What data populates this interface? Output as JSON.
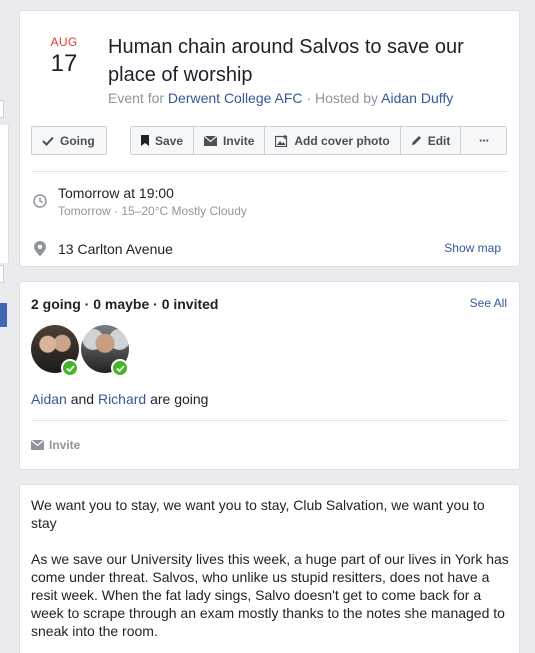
{
  "event": {
    "month": "AUG",
    "day": "17",
    "title": "Human chain around Salvos to save our place of worship",
    "meta_prefix": "Event for",
    "page_name": "Derwent College AFC",
    "meta_sep": " · Hosted by ",
    "host_name": "Aidan Duffy"
  },
  "actions": {
    "going": "Going",
    "save": "Save",
    "invite": "Invite",
    "add_cover": "Add cover photo",
    "edit": "Edit",
    "more": "···"
  },
  "details": {
    "time": "Tomorrow at 19:00",
    "weather": "Tomorrow · 15–20°C Mostly Cloudy",
    "address": "13 Carlton Avenue",
    "show_map": "Show map"
  },
  "guests": {
    "summary": "2 going · 0 maybe · 0 invited",
    "see_all": "See All",
    "name1": "Aidan",
    "and": " and ",
    "name2": "Richard",
    "suffix": " are going",
    "invite": "Invite"
  },
  "description": {
    "p1": "We want you to stay, we want you to stay, Club Salvation, we want you to stay",
    "p2": "As we save our University lives this week, a huge part of our lives in York has come under threat. Salvos, who unlike us stupid resitters, does not have a resit week. When the fat lady sings, Salvo doesn't get to come back for a week to scrape through an exam mostly thanks to the notes she managed to sneak into the room."
  },
  "colors": {
    "accent": "#4267b2",
    "link": "#365899",
    "date_red": "#e0393e",
    "going_green": "#42b72a"
  }
}
